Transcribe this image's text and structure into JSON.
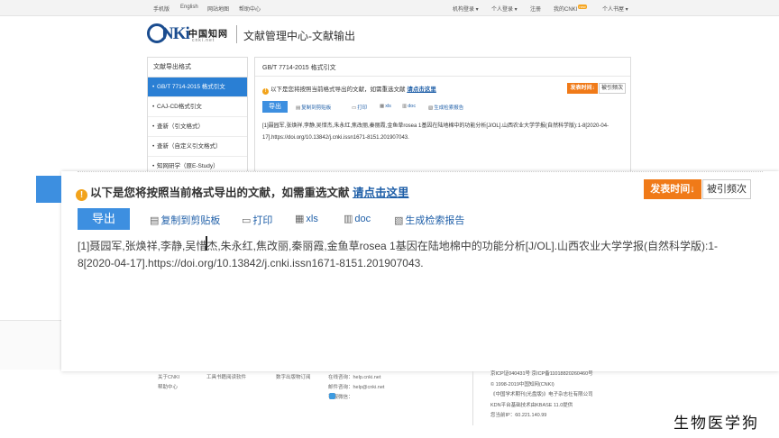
{
  "topbar": {
    "left_links": [
      "手机版",
      "English",
      "网站地图",
      "帮助中心"
    ],
    "org_login": "机构登录 ▾",
    "personal_login": "个人登录 ▾",
    "register": "注册",
    "my_cnki": "我的CNKI",
    "new_badge": "new",
    "personal_book": "个人书屋 ▾"
  },
  "header": {
    "logo_k": "NKi",
    "logo_han": "中国知网",
    "logo_net": "cnki.net",
    "title": "文献管理中心-文献输出"
  },
  "sidebar": {
    "title": "文献导出格式",
    "items": [
      {
        "label": "GB/T 7714-2015 格式引文",
        "active": true
      },
      {
        "label": "CAJ-CD格式引文",
        "active": false
      },
      {
        "label": "查新（引文格式）",
        "active": false
      },
      {
        "label": "查新（自定义引文格式）",
        "active": false
      },
      {
        "label": "知网研学（原E-Study）",
        "active": false
      }
    ]
  },
  "panel": {
    "title": "GB/T 7714-2015 格式引文",
    "notice": "以下是您将按照当前格式导出的文献，如需重选文献",
    "notice_link": "请点击这里",
    "publish_button": "发表时间",
    "cited_button": "被引频次",
    "export_button": "导出",
    "tools": [
      "复制到剪贴板",
      "打印",
      "xls",
      "doc",
      "生成检索报告"
    ],
    "citation": "[1]聂园军,张焕祥,李静,吴惜杰,朱永红,焦改丽,秦丽霞,金鱼草rosea 1基因在陆地棉中的功能分析[J/OL].山西农业大学学报(自然科学版):1-8[2020-04-17].https://doi.org/10.13842/j.cnki.issn1671-8151.201907043."
  },
  "zoom": {
    "notice": "以下是您将按照当前格式导出的文献，如需重选文献",
    "notice_link": "请点击这里",
    "publish_button": "发表时间",
    "cited_button": "被引频次",
    "export_button": "导出",
    "tools": [
      "复制到剪贴板",
      "打印",
      "xls",
      "doc",
      "生成检索报告"
    ],
    "citation": "[1]聂园军,张焕祥,李静,吴惜杰,朱永红,焦改丽,秦丽霞,金鱼草rosea 1基因在陆地棉中的功能分析[J/OL].山西农业大学学报(自然科学版):1-8[2020-04-17].https://doi.org/10.13842/j.cnki.issn1671-8151.201907043."
  },
  "footer": {
    "about": "关于CNKI",
    "help": "帮助中心",
    "tools_download": "工具书籍阅读软件",
    "pay": "数字出版物订阅",
    "online_consult": "在线咨询：help.cnki.net",
    "email": "邮件咨询：help@cnki.net",
    "follow": "客服微信：",
    "icp": "京ICP证040431号 京ICP备11018820260460号",
    "copyright": "© 1998-2019中国知网(CNKI)",
    "publisher": "《中国学术期刊(光盘版)》电子杂志社有限公司",
    "kbase": "KDN平台基础技术由KBASE 11.0提供",
    "ip": "您当前IP：60.221.140.99"
  },
  "watermark": "生物医学狗",
  "colors": {
    "brand_blue": "#3d8fe0",
    "orange": "#f07a18",
    "link": "#1f5fa8",
    "warn": "#f2a31b"
  }
}
